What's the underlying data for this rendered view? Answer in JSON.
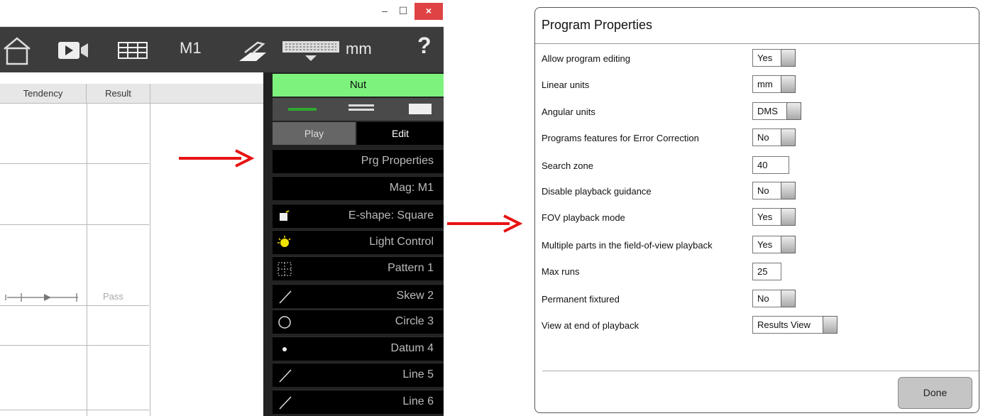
{
  "window": {
    "minimize_glyph": "–",
    "maximize_glyph": "☐",
    "close_glyph": "×"
  },
  "toolbar": {
    "icons": [
      "home-icon",
      "video-icon",
      "grid-icon",
      "stage-icon",
      "keyboard-icon"
    ],
    "magnification": "M1",
    "units": "mm",
    "help": "?"
  },
  "table": {
    "columns": [
      "Tendency",
      "Result"
    ],
    "result_value": "Pass"
  },
  "panel": {
    "part_name": "Nut",
    "tabs": [
      "Play",
      "Edit"
    ],
    "items": [
      {
        "label": "Prg Properties",
        "icon": ""
      },
      {
        "label": "Mag: M1",
        "icon": ""
      },
      {
        "label": "E-shape: Square",
        "icon": "square-shape-icon"
      },
      {
        "label": "Light Control",
        "icon": "light-bulb-icon"
      },
      {
        "label": "Pattern 1",
        "icon": "pattern-icon"
      },
      {
        "label": "Skew 2",
        "icon": "skew-line-icon"
      },
      {
        "label": "Circle 3",
        "icon": "circle-icon"
      },
      {
        "label": "Datum 4",
        "icon": "datum-point-icon"
      },
      {
        "label": "Line 5",
        "icon": "line-icon"
      },
      {
        "label": "Line 6",
        "icon": "line-icon"
      }
    ]
  },
  "dialog": {
    "title": "Program Properties",
    "properties": [
      {
        "label": "Allow program editing",
        "value": "Yes"
      },
      {
        "label": "Linear units",
        "value": "mm"
      },
      {
        "label": "Angular units",
        "value": "DMS"
      },
      {
        "label": "Programs features for Error Correction",
        "value": "No"
      },
      {
        "label": "Search zone",
        "value": "40"
      },
      {
        "label": "Disable playback guidance",
        "value": "No"
      },
      {
        "label": "FOV playback mode",
        "value": "Yes"
      },
      {
        "label": "Multiple parts in the field-of-view playback",
        "value": "Yes"
      },
      {
        "label": "Max runs",
        "value": "25"
      },
      {
        "label": "Permanent fixtured",
        "value": "No"
      },
      {
        "label": "View at end of playback",
        "value": "Results View"
      }
    ],
    "done_label": "Done"
  },
  "colors": {
    "annotation_arrow": "#e81313",
    "part_name_bg": "#7df27d",
    "toolbar_bg": "#3c3c3c",
    "close_button": "#e04343"
  }
}
